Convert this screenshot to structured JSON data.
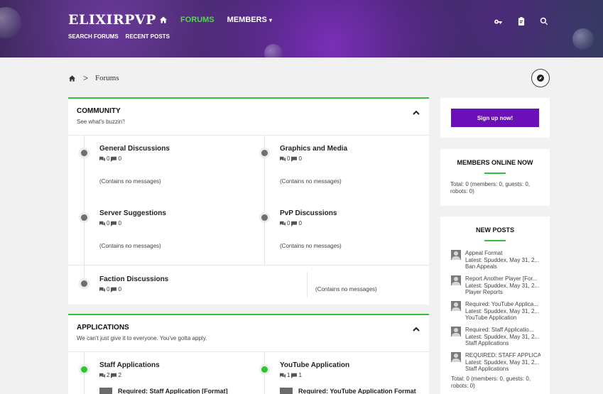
{
  "header": {
    "logo": "ELIXIRPVP",
    "nav": {
      "forums": "FORUMS",
      "members": "MEMBERS",
      "members_caret": "▾"
    },
    "subnav": {
      "search": "SEARCH FORUMS",
      "recent": "RECENT POSTS"
    },
    "accent": "#5ad05a"
  },
  "breadcrumb": {
    "separator": ">",
    "current": "Forums"
  },
  "categories": [
    {
      "title": "COMMUNITY",
      "description": "See what's buzzin'!",
      "forums": [
        {
          "title": "General Discussions",
          "threads": "0",
          "messages": "0",
          "status": "(Contains no messages)"
        },
        {
          "title": "Graphics and Media",
          "threads": "0",
          "messages": "0",
          "status": "(Contains no messages)"
        },
        {
          "title": "Server Suggestions",
          "threads": "0",
          "messages": "0",
          "status": "(Contains no messages)"
        },
        {
          "title": "PvP Discussions",
          "threads": "0",
          "messages": "0",
          "status": "(Contains no messages)"
        },
        {
          "title": "Faction Discussions",
          "threads": "0",
          "messages": "0",
          "status": "(Contains no messages)"
        }
      ]
    },
    {
      "title": "APPLICATIONS",
      "description": "We can't just give it to everyone. You've gotta apply.",
      "forums": [
        {
          "title": "Staff Applications",
          "threads": "2",
          "messages": "2",
          "latest": "Required: Staff Application [Format]"
        },
        {
          "title": "YouTube Application",
          "threads": "1",
          "messages": "1",
          "latest": "Required: YouTube Application Format"
        }
      ]
    }
  ],
  "sidebar": {
    "signup": "Sign up now!",
    "members_online": {
      "title": "MEMBERS ONLINE NOW",
      "text": "Total: 0 (members: 0, guests: 0, robots: 0)"
    },
    "new_posts": {
      "title": "NEW POSTS",
      "items": [
        {
          "title": "Appeal Format",
          "latest": "Latest: Spuddex, May 31, 2...",
          "forum": "Ban Appeals"
        },
        {
          "title": "Report Another Player [For...",
          "latest": "Latest: Spuddex, May 31, 2...",
          "forum": "Player Reports"
        },
        {
          "title": "Required: YouTube Applica...",
          "latest": "Latest: Spuddex, May 31, 2...",
          "forum": "YouTube Application"
        },
        {
          "title": "Required: Staff Applicatio...",
          "latest": "Latest: Spuddex, May 31, 2...",
          "forum": "Staff Applications"
        },
        {
          "title": "REQUIRED: STAFF APPLICAT...",
          "latest": "Latest: Spuddex, May 31, 2...",
          "forum": "Staff Applications"
        }
      ],
      "footer": "Total: 0 (members: 0, guests: 0, robots: 0)"
    }
  }
}
